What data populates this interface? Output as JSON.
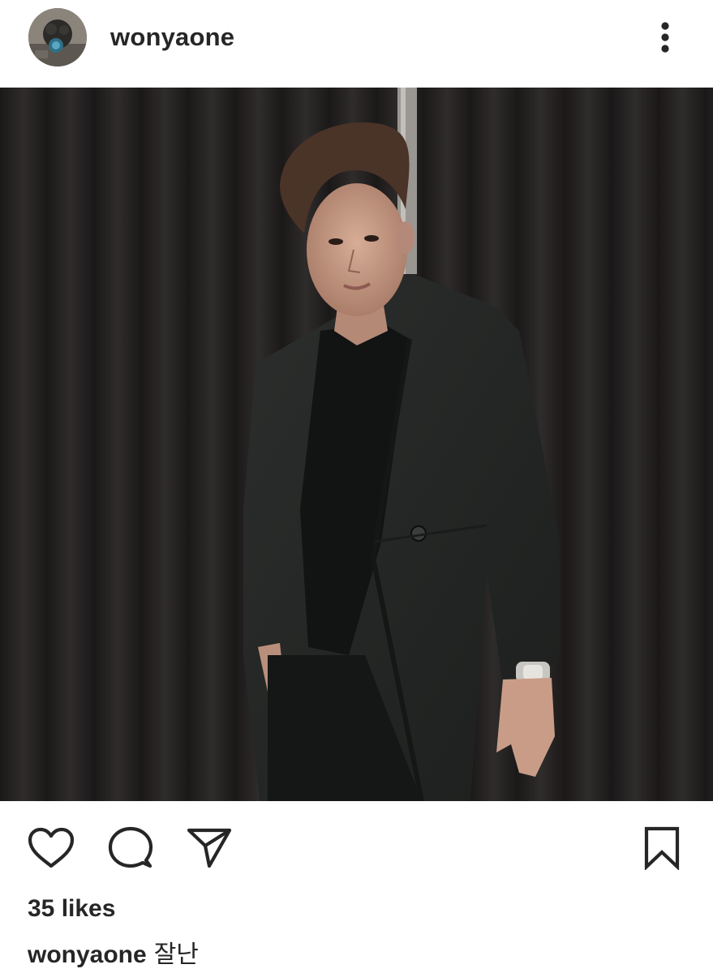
{
  "header": {
    "username": "wonyaone",
    "avatar_icon": "profile-photo",
    "more_icon": "more-vertical-icon"
  },
  "post": {
    "photo_icon": "post-photo"
  },
  "actions": {
    "like_icon": "heart-icon",
    "comment_icon": "comment-icon",
    "share_icon": "send-icon",
    "save_icon": "bookmark-icon"
  },
  "meta": {
    "likes": "35 likes",
    "caption_username": "wonyaone",
    "caption_text": "잘난"
  },
  "colors": {
    "text": "#262626",
    "background": "#ffffff",
    "photo_background": "#2b2828"
  }
}
